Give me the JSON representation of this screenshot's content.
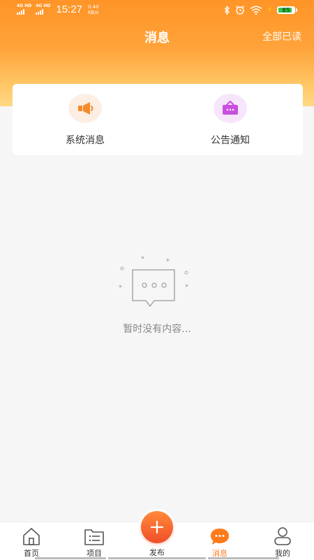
{
  "status_bar": {
    "sim1": "4G HD",
    "sim2": "4G HD",
    "time": "15:27",
    "speed_value": "0.40",
    "speed_unit": "KB/s",
    "battery_level": "85"
  },
  "header": {
    "title": "消息",
    "mark_all_read": "全部已读"
  },
  "categories": [
    {
      "label": "系统消息",
      "icon": "megaphone-icon",
      "icon_bg": "#fdeee4",
      "icon_color": "#f58a2a"
    },
    {
      "label": "公告通知",
      "icon": "notice-board-icon",
      "icon_bg": "#f7e6fb",
      "icon_color": "#c94fe0"
    }
  ],
  "empty_state": {
    "icon": "empty-message-icon",
    "text": "暂时没有内容..."
  },
  "tabbar": {
    "items": [
      {
        "label": "首页",
        "icon": "home-icon",
        "active": false
      },
      {
        "label": "项目",
        "icon": "folder-list-icon",
        "active": false
      },
      {
        "label": "发布",
        "icon": "plus-icon",
        "active": false
      },
      {
        "label": "消息",
        "icon": "chat-bubble-icon",
        "active": true
      },
      {
        "label": "我的",
        "icon": "user-icon",
        "active": false
      }
    ]
  },
  "colors": {
    "accent": "#ff7a1a",
    "header_top": "#ff9427",
    "header_bottom": "#ffd885",
    "publish_button": "#f14d2a"
  }
}
